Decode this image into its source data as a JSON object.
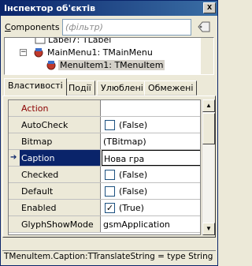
{
  "window": {
    "title": "Інспектор об'єктів",
    "close_symbol": "x"
  },
  "components": {
    "label_accel": "C",
    "label_rest": "omponents",
    "placeholder": "(фільтр)"
  },
  "tree": {
    "items": [
      {
        "label": "Label7: TLabel"
      },
      {
        "label": "MainMenu1: TMainMenu",
        "expander": "−"
      },
      {
        "label": "MenuItem1: TMenuItem"
      }
    ]
  },
  "tabs": [
    {
      "label": "Властивості"
    },
    {
      "label": "Події"
    },
    {
      "label": "Улюблені"
    },
    {
      "label": "Обмежені"
    }
  ],
  "properties": [
    {
      "name": "Action",
      "value": ""
    },
    {
      "name": "AutoCheck",
      "value": "(False)"
    },
    {
      "name": "Bitmap",
      "value": "(TBitmap)"
    },
    {
      "name": "Caption",
      "value": "Нова гра"
    },
    {
      "name": "Checked",
      "value": "(False)"
    },
    {
      "name": "Default",
      "value": "(False)"
    },
    {
      "name": "Enabled",
      "value": "(True)",
      "check_mark": "✓"
    },
    {
      "name": "GlyphShowMode",
      "value": "gsmApplication"
    }
  ],
  "status": {
    "text": "TMenuItem.Caption:TTranslateString = type String"
  },
  "colors": {
    "selection": "#0a246a",
    "action_name": "#8b0000",
    "face": "#ece9d8"
  }
}
